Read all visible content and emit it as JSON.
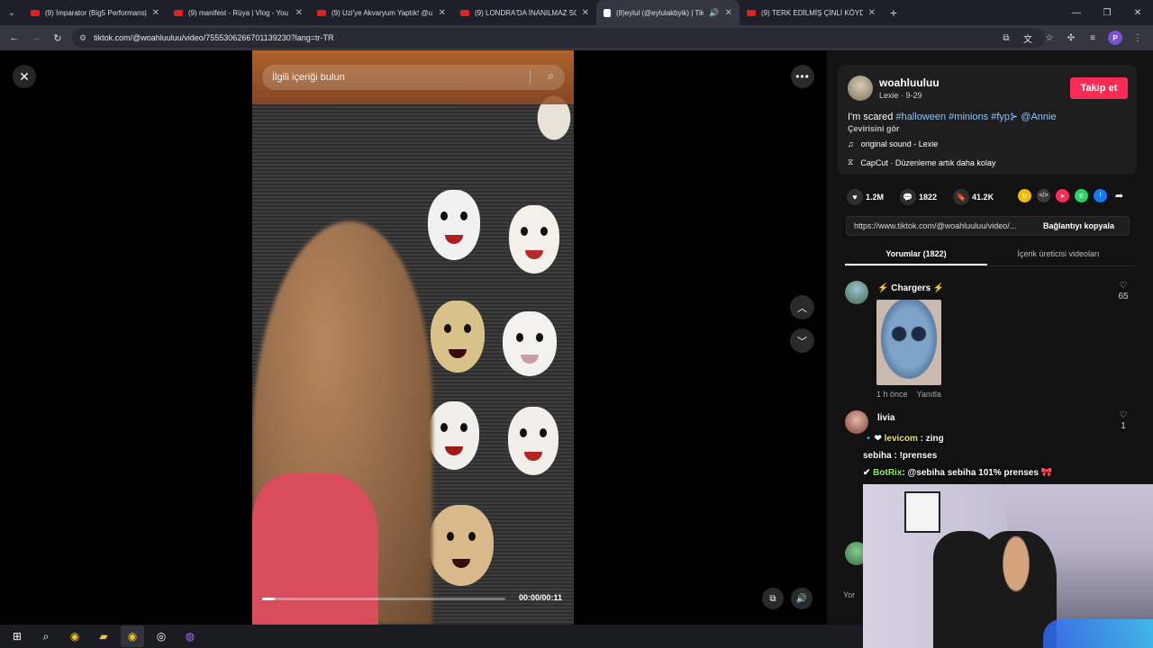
{
  "browser": {
    "tabs": [
      {
        "label": "(9) İmparator (Big5 Performans|",
        "active": false,
        "icon": "youtube-icon"
      },
      {
        "label": "(9) manifest - Rüya | Vlog - You",
        "active": false,
        "icon": "youtube-icon"
      },
      {
        "label": "(9) Uzi'ye Akvaryum Yaptık! @u",
        "active": false,
        "icon": "youtube-icon"
      },
      {
        "label": "(9) LONDRA'DA İNANILMAZ SO",
        "active": false,
        "icon": "youtube-icon"
      },
      {
        "label": "(8)eylul (@eylulakbyik) | Tik",
        "active": true,
        "icon": "tiktok-icon"
      },
      {
        "label": "(9) TERK EDİLMİŞ ÇİNLİ KÖYDE",
        "active": false,
        "icon": "youtube-icon"
      }
    ],
    "url": "tiktok.com/@woahluuluu/video/7555306266701139230?lang=tr-TR",
    "profile_initial": "P"
  },
  "video": {
    "search_placeholder": "İlgili içeriği bulun",
    "time": "00:00/00:11",
    "progress": 0.05
  },
  "panel": {
    "username": "woahluuluu",
    "meta": "Lexie · 9-29",
    "follow_label": "Takip et",
    "caption_text": "I'm scared ",
    "caption_tags": "#halloween #minions #fyp⊱ @Annie",
    "translate_label": "Çevirisini gör",
    "sound": "original sound - Lexie",
    "capcut": "CapCut · Düzenleme artık daha kolay",
    "likes": "1.2M",
    "comments": "1822",
    "saves": "41.2K",
    "link_url": "https://www.tiktok.com/@woahluuluu/video/...",
    "copy_label": "Bağlantıyı kopyala",
    "tab_comments": "Yorumlar (1822)",
    "tab_creator": "İçerik üreticisi videoları",
    "comment_placeholder": "Yor"
  },
  "comments": [
    {
      "name": "⚡ Chargers ⚡",
      "time": "1 h önce",
      "reply": "Yanıtla",
      "likes": "65"
    },
    {
      "name": "livia",
      "likes": "1"
    }
  ],
  "stream_chat": [
    {
      "user": "levicom",
      "text": "zing"
    },
    {
      "user": "sebiha",
      "text": "!prenses"
    },
    {
      "user": "BotRix",
      "text": "@sebiha sebiha 101% prenses 🎀"
    }
  ]
}
